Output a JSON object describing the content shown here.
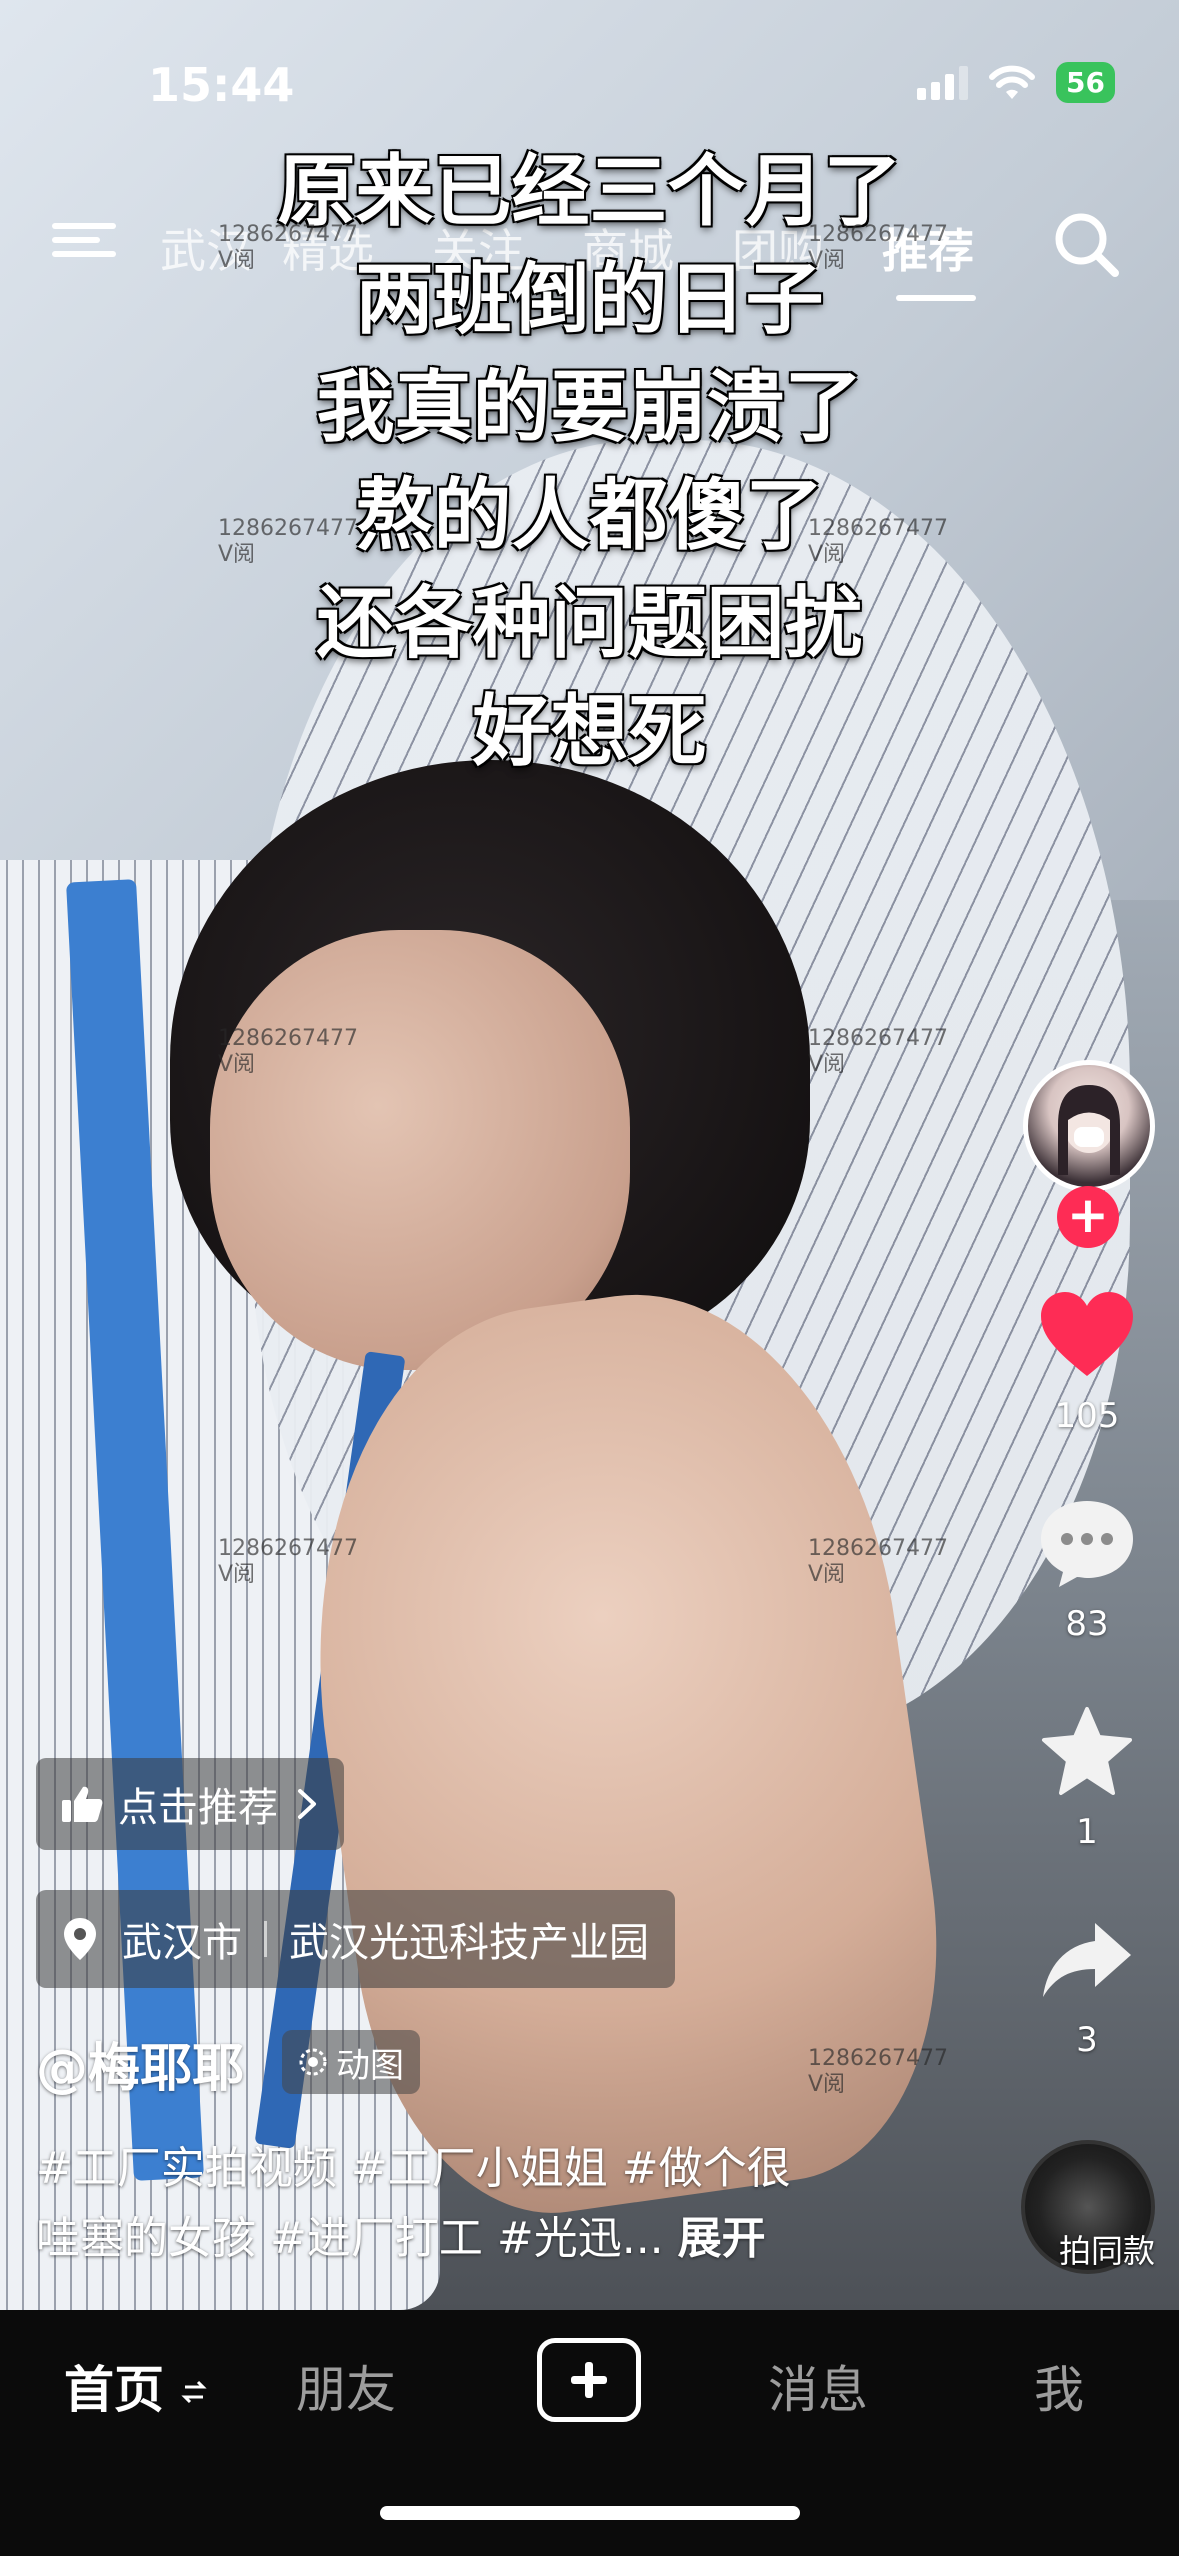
{
  "status_bar": {
    "time": "15:44",
    "battery": "56"
  },
  "top_nav": {
    "tabs": [
      "武汉",
      "精选",
      "关注",
      "商城",
      "团购",
      "推荐"
    ],
    "active_tab": "推荐"
  },
  "caption_lines": [
    "原来已经三个月了",
    "两班倒的日子",
    "我真的要崩溃了",
    "熬的人都傻了",
    "还各种问题困扰",
    "好想死"
  ],
  "watermark": {
    "line1": "1286267477",
    "line2": "V阅"
  },
  "sidebar": {
    "like_count": "105",
    "comment_count": "83",
    "favorite_count": "1",
    "share_count": "3",
    "music_label": "拍同款",
    "colors": {
      "like": "#fe2c55",
      "follow": "#fe2c55"
    }
  },
  "recommend_label": "点击推荐",
  "location": {
    "city": "武汉市",
    "place": "武汉光迅科技产业园"
  },
  "author": "@梅耶耶",
  "anim_tag": "动图",
  "description": {
    "line1": "#工厂实拍视频 #工厂小姐姐 #做个很",
    "line2": "哇塞的女孩 #进厂打工 #光迅...",
    "expand": "展开"
  },
  "bottom_nav": {
    "home": "首页",
    "friends": "朋友",
    "messages": "消息",
    "me": "我"
  }
}
